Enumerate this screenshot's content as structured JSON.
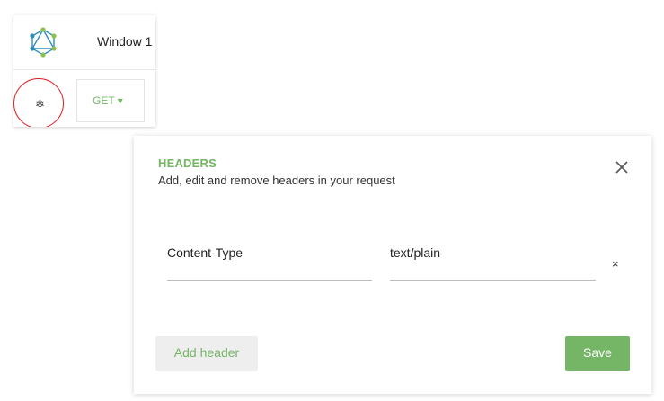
{
  "colors": {
    "accent": "#74b566",
    "focus_ring": "#e0191f"
  },
  "window": {
    "title": "Window 1",
    "logo_icon": "graphql-logo-icon"
  },
  "request": {
    "settings_icon": "gear-icon",
    "settings_glyph": "❄",
    "method_label": "GET ▾"
  },
  "headers_dialog": {
    "title": "HEADERS",
    "subtitle": "Add, edit and remove headers in your request",
    "close_icon": "close-icon",
    "rows": [
      {
        "key": "Content-Type",
        "value": "text/plain",
        "remove_label": "×"
      }
    ],
    "add_label": "Add header",
    "save_label": "Save"
  }
}
